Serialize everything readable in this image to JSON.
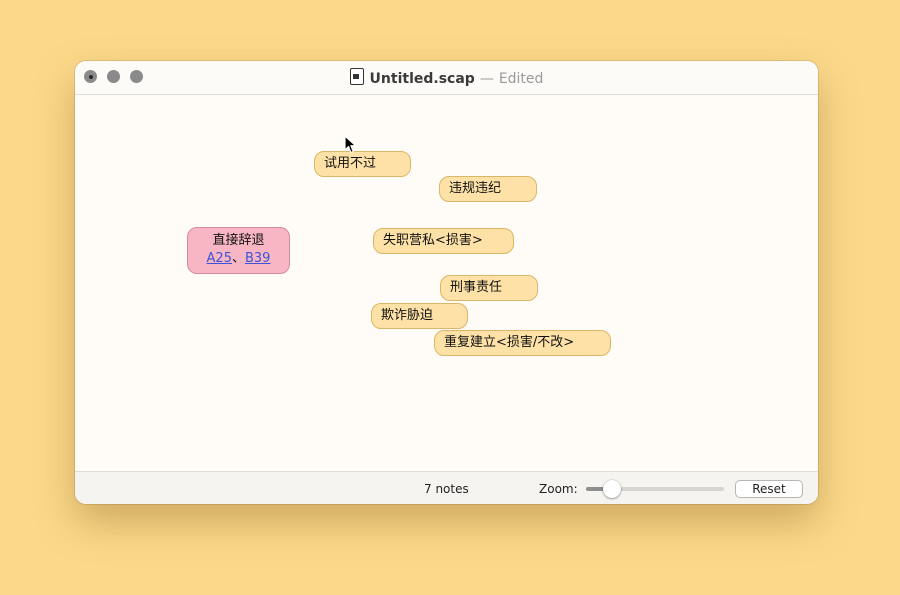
{
  "window": {
    "title": "Untitled.scap",
    "separator": "—",
    "status": "Edited"
  },
  "notes": [
    {
      "text": "试用不过",
      "color": "#fde1a6"
    },
    {
      "text": "违规违纪",
      "color": "#fde1a6"
    },
    {
      "text": "失职营私<损害>",
      "color": "#fde1a6"
    },
    {
      "text": "刑事责任",
      "color": "#fde1a6"
    },
    {
      "text": "欺诈胁迫",
      "color": "#fde1a6"
    },
    {
      "text": "重复建立<损害/不改>",
      "color": "#fde1a6"
    }
  ],
  "result_note": {
    "title": "直接辞退",
    "link1": "A25",
    "separator": "、",
    "link2": "B39",
    "color": "#f8b5c3"
  },
  "statusbar": {
    "count": "7 notes",
    "zoom_label": "Zoom:",
    "zoom_level": 0.19,
    "reset_label": "Reset"
  },
  "colors": {
    "background": "#fcd98a",
    "note": "#fde1a6",
    "pink_note": "#f8b5c3",
    "link": "#3b55d6"
  }
}
